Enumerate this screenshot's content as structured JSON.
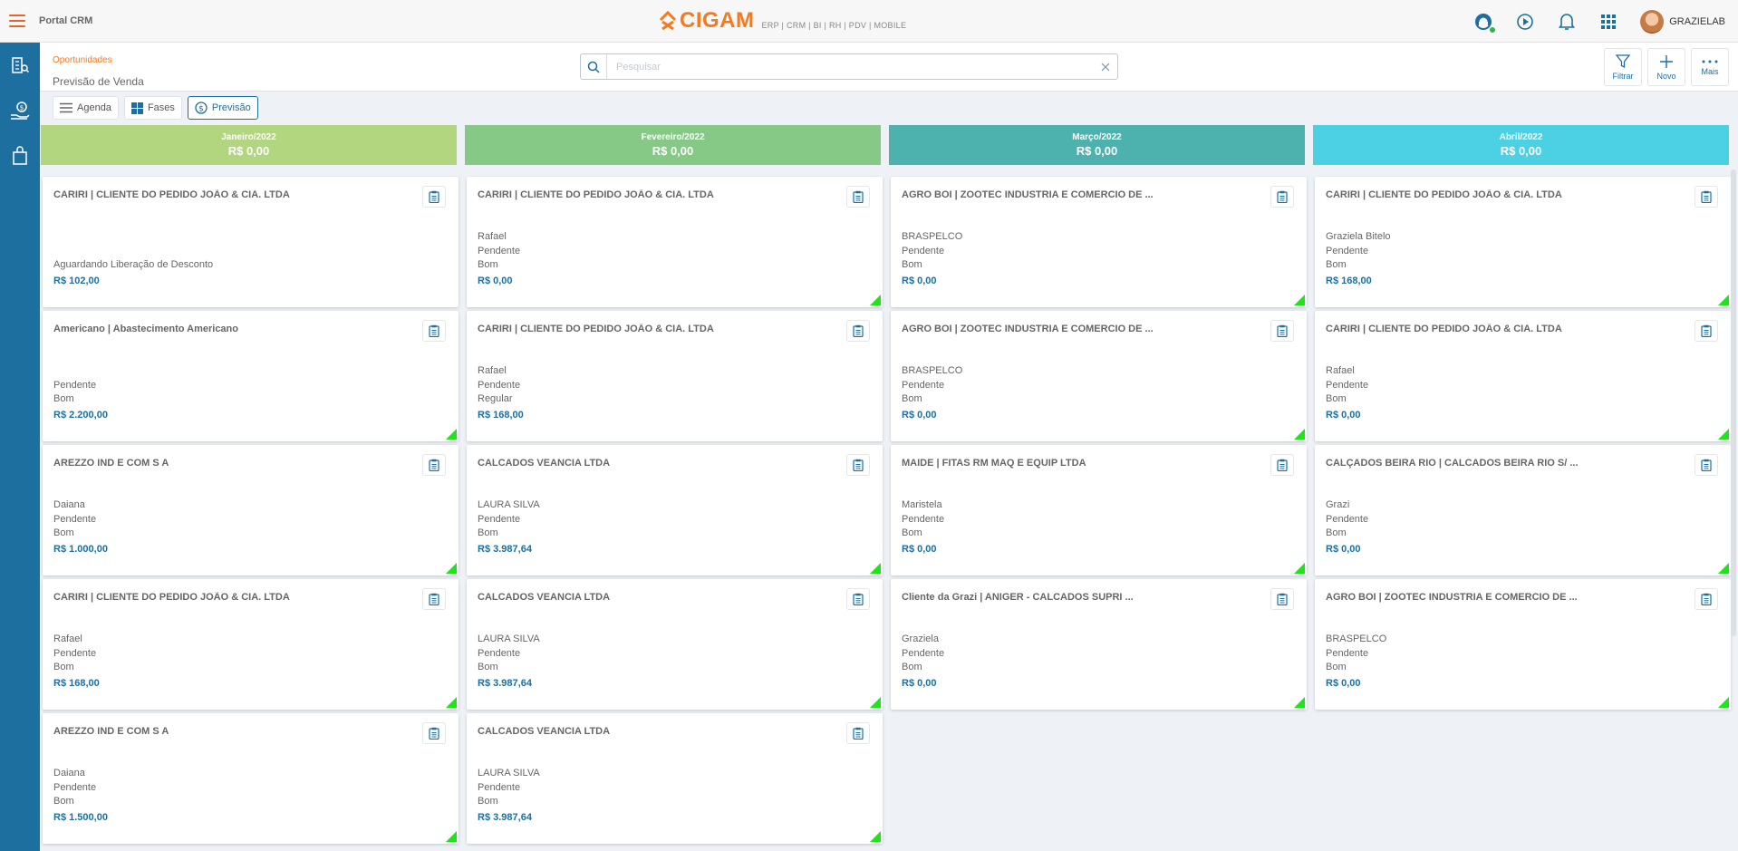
{
  "header": {
    "app_title": "Portal CRM",
    "brand_name": "CIGAM",
    "brand_tagline": "ERP | CRM | BI | RH | PDV | MOBILE",
    "user_name": "GRAZIELAB"
  },
  "subheader": {
    "breadcrumb": "Oportunidades",
    "page_title": "Previsão de Venda",
    "search_placeholder": "Pesquisar",
    "actions": {
      "filter": "Filtrar",
      "new": "Novo",
      "more": "Mais"
    }
  },
  "views": {
    "agenda": "Agenda",
    "fases": "Fases",
    "previsao": "Previsão"
  },
  "colors": {
    "accent": "#1d6fa0",
    "brand": "#f47a20",
    "jan": "#b2d67f",
    "feb": "#86c986",
    "mar": "#4db2ad",
    "apr": "#4cd0e3"
  },
  "columns": [
    {
      "month": "Janeiro/2022",
      "total": "R$ 0,00",
      "cards": [
        {
          "title": "CARIRI | CLIENTE DO PEDIDO JOÃO & CIA. LTDA",
          "lines": [
            "Aguardando Liberação de Desconto"
          ],
          "value": "R$ 102,00",
          "flag": false
        },
        {
          "title": "Americano | Abastecimento Americano",
          "lines": [
            "Pendente",
            "Bom"
          ],
          "value": "R$ 2.200,00",
          "flag": true
        },
        {
          "title": "AREZZO IND E COM S A",
          "lines": [
            "Daiana",
            "Pendente",
            "Bom"
          ],
          "value": "R$ 1.000,00",
          "flag": true
        },
        {
          "title": "CARIRI | CLIENTE DO PEDIDO JOÃO & CIA. LTDA",
          "lines": [
            "Rafael",
            "Pendente",
            "Bom"
          ],
          "value": "R$ 168,00",
          "flag": true
        },
        {
          "title": "AREZZO IND E COM S A",
          "lines": [
            "Daiana",
            "Pendente",
            "Bom"
          ],
          "value": "R$ 1.500,00",
          "flag": true
        }
      ]
    },
    {
      "month": "Fevereiro/2022",
      "total": "R$ 0,00",
      "cards": [
        {
          "title": "CARIRI | CLIENTE DO PEDIDO JOÃO & CIA. LTDA",
          "lines": [
            "Rafael",
            "Pendente",
            "Bom"
          ],
          "value": "R$ 0,00",
          "flag": true
        },
        {
          "title": "CARIRI | CLIENTE DO PEDIDO JOÃO & CIA. LTDA",
          "lines": [
            "Rafael",
            "Pendente",
            "Regular"
          ],
          "value": "R$ 168,00",
          "flag": false
        },
        {
          "title": "CALCADOS VEANCIA LTDA",
          "lines": [
            "LAURA SILVA",
            "Pendente",
            "Bom"
          ],
          "value": "R$ 3.987,64",
          "flag": true
        },
        {
          "title": "CALCADOS VEANCIA LTDA",
          "lines": [
            "LAURA SILVA",
            "Pendente",
            "Bom"
          ],
          "value": "R$ 3.987,64",
          "flag": true
        },
        {
          "title": "CALCADOS VEANCIA LTDA",
          "lines": [
            "LAURA SILVA",
            "Pendente",
            "Bom"
          ],
          "value": "R$ 3.987,64",
          "flag": true
        }
      ]
    },
    {
      "month": "Março/2022",
      "total": "R$ 0,00",
      "cards": [
        {
          "title": "AGRO BOI | ZOOTEC INDUSTRIA E COMERCIO DE ...",
          "lines": [
            "BRASPELCO",
            "Pendente",
            "Bom"
          ],
          "value": "R$ 0,00",
          "flag": true
        },
        {
          "title": "AGRO BOI | ZOOTEC INDUSTRIA E COMERCIO DE ...",
          "lines": [
            "BRASPELCO",
            "Pendente",
            "Bom"
          ],
          "value": "R$ 0,00",
          "flag": true
        },
        {
          "title": "MAIDE | FITAS RM MAQ E EQUIP LTDA",
          "lines": [
            "Maristela",
            "Pendente",
            "Bom"
          ],
          "value": "R$ 0,00",
          "flag": true
        },
        {
          "title": "Cliente da Grazi | ANIGER - CALCADOS SUPRI ...",
          "lines": [
            "Graziela",
            "Pendente",
            "Bom"
          ],
          "value": "R$ 0,00",
          "flag": true
        }
      ]
    },
    {
      "month": "Abril/2022",
      "total": "R$ 0,00",
      "cards": [
        {
          "title": "CARIRI | CLIENTE DO PEDIDO JOÃO & CIA. LTDA",
          "lines": [
            "Graziela Bitelo",
            "Pendente",
            "Bom"
          ],
          "value": "R$ 168,00",
          "flag": true
        },
        {
          "title": "CARIRI | CLIENTE DO PEDIDO JOÃO & CIA. LTDA",
          "lines": [
            "Rafael",
            "Pendente",
            "Bom"
          ],
          "value": "R$ 0,00",
          "flag": true
        },
        {
          "title": "CALÇADOS BEIRA RIO | CALCADOS BEIRA RIO S/ ...",
          "lines": [
            "Grazi",
            "Pendente",
            "Bom"
          ],
          "value": "R$ 0,00",
          "flag": true
        },
        {
          "title": "AGRO BOI | ZOOTEC INDUSTRIA E COMERCIO DE ...",
          "lines": [
            "BRASPELCO",
            "Pendente",
            "Bom"
          ],
          "value": "R$ 0,00",
          "flag": true
        }
      ]
    }
  ]
}
